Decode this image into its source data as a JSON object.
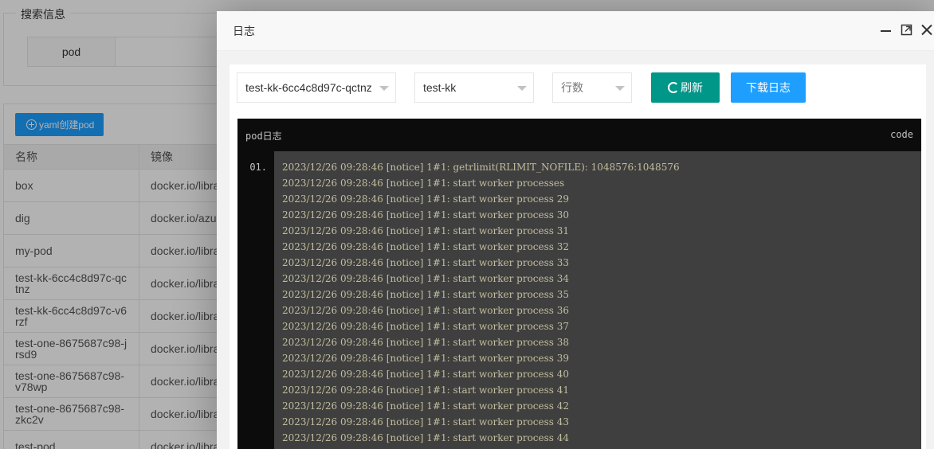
{
  "background": {
    "search_legend": "搜索信息",
    "search_label": "pod",
    "create_button": "yaml创建pod",
    "table": {
      "headers": [
        "名称",
        "镜像"
      ],
      "rows": [
        {
          "name": "box",
          "image": "docker.io/libra"
        },
        {
          "name": "dig",
          "image": "docker.io/azu"
        },
        {
          "name": "my-pod",
          "image": "docker.io/libra"
        },
        {
          "name": "test-kk-6cc4c8d97c-qctnz",
          "image": "docker.io/libra"
        },
        {
          "name": "test-kk-6cc4c8d97c-v6rzf",
          "image": "docker.io/libra"
        },
        {
          "name": "test-one-8675687c98-jrsd9",
          "image": "docker.io/libra"
        },
        {
          "name": "test-one-8675687c98-v78wp",
          "image": "docker.io/libra"
        },
        {
          "name": "test-one-8675687c98-zkc2v",
          "image": "docker.io/libra"
        },
        {
          "name": "test-pod",
          "image": "docker.io/libra"
        }
      ]
    }
  },
  "modal": {
    "title": "日志",
    "controls": {
      "pod_select": "test-kk-6cc4c8d97c-qctnz",
      "container_select": "test-kk",
      "lines_placeholder": "行数",
      "refresh_label": "刷新",
      "download_label": "下载日志"
    },
    "code": {
      "title": "pod日志",
      "tag": "code",
      "line_number": "01.",
      "lines": [
        "2023/12/26 09:28:46 [notice] 1#1: getrlimit(RLIMIT_NOFILE): 1048576:1048576",
        "2023/12/26 09:28:46 [notice] 1#1: start worker processes",
        "2023/12/26 09:28:46 [notice] 1#1: start worker process 29",
        "2023/12/26 09:28:46 [notice] 1#1: start worker process 30",
        "2023/12/26 09:28:46 [notice] 1#1: start worker process 31",
        "2023/12/26 09:28:46 [notice] 1#1: start worker process 32",
        "2023/12/26 09:28:46 [notice] 1#1: start worker process 33",
        "2023/12/26 09:28:46 [notice] 1#1: start worker process 34",
        "2023/12/26 09:28:46 [notice] 1#1: start worker process 35",
        "2023/12/26 09:28:46 [notice] 1#1: start worker process 36",
        "2023/12/26 09:28:46 [notice] 1#1: start worker process 37",
        "2023/12/26 09:28:46 [notice] 1#1: start worker process 38",
        "2023/12/26 09:28:46 [notice] 1#1: start worker process 39",
        "2023/12/26 09:28:46 [notice] 1#1: start worker process 40",
        "2023/12/26 09:28:46 [notice] 1#1: start worker process 41",
        "2023/12/26 09:28:46 [notice] 1#1: start worker process 42",
        "2023/12/26 09:28:46 [notice] 1#1: start worker process 43",
        "2023/12/26 09:28:46 [notice] 1#1: start worker process 44"
      ]
    }
  },
  "colors": {
    "refresh_button": "#009688",
    "download_button": "#1e9fff",
    "code_background": "#3f3f3f",
    "code_text": "#c2be9e"
  }
}
